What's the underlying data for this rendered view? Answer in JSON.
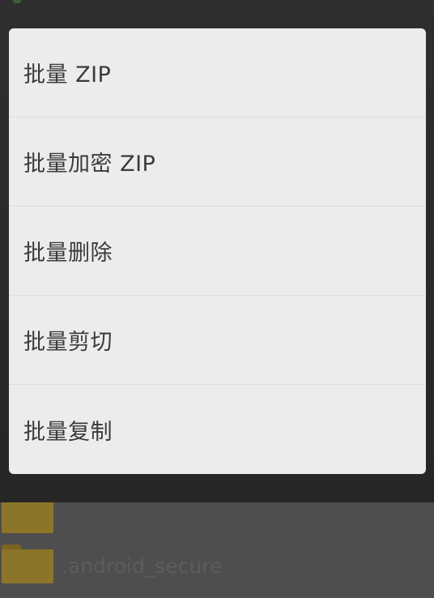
{
  "menu": {
    "items": [
      {
        "label": "批量 ZIP"
      },
      {
        "label": "批量加密 ZIP"
      },
      {
        "label": "批量删除"
      },
      {
        "label": "批量剪切"
      },
      {
        "label": "批量复制"
      }
    ]
  },
  "background_list": {
    "items": [
      {
        "name": "",
        "icon": "folder-icon"
      },
      {
        "name": ".android_secure",
        "icon": "folder-icon"
      }
    ]
  }
}
